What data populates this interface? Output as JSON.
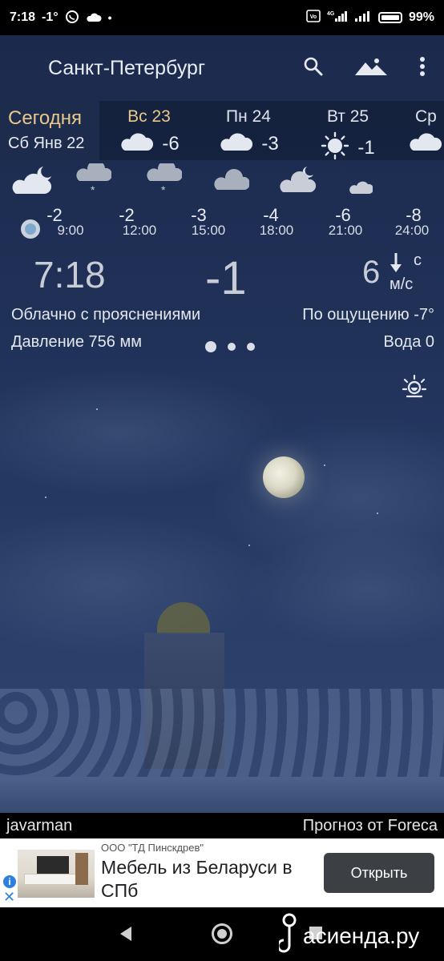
{
  "status_bar": {
    "time": "7:18",
    "temp": "-1°",
    "battery": "99%",
    "icons": [
      "whatsapp-icon",
      "cloud-icon",
      "dot-icon",
      "volte-icon",
      "4g-signal-icon",
      "signal-icon",
      "battery-icon"
    ]
  },
  "header": {
    "city": "Санкт-Петербург",
    "actions": [
      "search-icon",
      "landscape-icon",
      "more-vert-icon"
    ]
  },
  "days": {
    "today": {
      "label": "Сегодня",
      "date": "Сб Янв 22"
    },
    "list": [
      {
        "name": "Вс 23",
        "temp": "-6",
        "icon": "cloud-icon",
        "highlight": true
      },
      {
        "name": "Пн 24",
        "temp": "-3",
        "icon": "cloud-icon",
        "highlight": false
      },
      {
        "name": "Вт 25",
        "temp": "-1",
        "icon": "sun-icon",
        "highlight": false
      },
      {
        "name": "Ср",
        "temp": "",
        "icon": "cloud-icon",
        "highlight": false
      }
    ]
  },
  "hourly": [
    {
      "temp": "-2",
      "time": "9:00",
      "icon": "cloud-moon-icon"
    },
    {
      "temp": "-2",
      "time": "12:00",
      "icon": "cloud-snow-icon"
    },
    {
      "temp": "-3",
      "time": "15:00",
      "icon": "cloud-snow-icon"
    },
    {
      "temp": "-4",
      "time": "18:00",
      "icon": "cloud-icon"
    },
    {
      "temp": "-6",
      "time": "21:00",
      "icon": "cloud-moon-icon"
    },
    {
      "temp": "-8",
      "time": "24:00",
      "icon": "moon-cloud-icon"
    }
  ],
  "current": {
    "time": "7:18",
    "temp": "-1",
    "wind_value": "6",
    "wind_unit_top": "с",
    "wind_unit": "м/с",
    "description": "Облачно с прояснениями",
    "feels_like": "По ощущению -7°",
    "pressure": "Давление 756 мм",
    "water": "Вода 0"
  },
  "footer": {
    "author": "javarman",
    "source": "Прогноз от Foreca"
  },
  "ad": {
    "sponsor": "ООО \"ТД Пинскдрев\"",
    "title": "Мебель из Беларуси в СПб",
    "button": "Открыть",
    "info_icon": "i",
    "close_icon": "✕"
  },
  "watermark": {
    "text": "асиенда.ру"
  },
  "colors": {
    "accent_gold": "#e8c98a",
    "background": "#1f2f55",
    "ad_button": "#3c3f44"
  }
}
